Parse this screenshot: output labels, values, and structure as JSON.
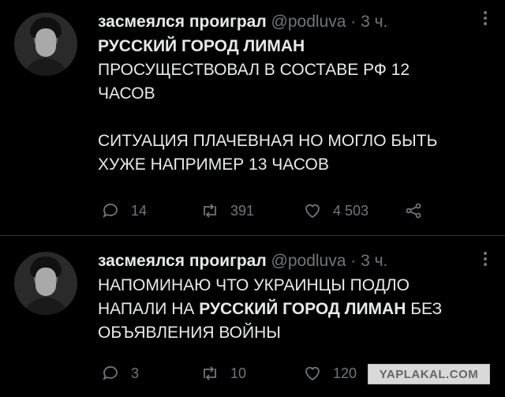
{
  "tweets": [
    {
      "author_name": "засмеялся проиграл",
      "handle": "@podluva",
      "time": "3 ч.",
      "text_bold": "РУССКИЙ ГОРОД ЛИМАН",
      "text_line1": "ПРОСУЩЕСТВОВАЛ В СОСТАВЕ РФ 12",
      "text_line2": "ЧАСОВ",
      "text_line3": "СИТУАЦИЯ ПЛАЧЕВНАЯ НО МОГЛО БЫТЬ",
      "text_line4": "ХУЖЕ НАПРИМЕР 13 ЧАСОВ",
      "replies": "14",
      "retweets": "391",
      "likes": "4 503"
    },
    {
      "author_name": "засмеялся проиграл",
      "handle": "@podluva",
      "time": "3 ч.",
      "text_line1": "НАПОМИНАЮ ЧТО УКРАИНЦЫ ПОДЛО",
      "text_line2_pre": "НАПАЛИ НА ",
      "text_line2_bold": "РУССКИЙ ГОРОД ЛИМАН",
      "text_line2_post": " БЕЗ",
      "text_line3": "ОБЪЯВЛЕНИЯ ВОЙНЫ",
      "replies": "3",
      "retweets": "10",
      "likes": "120"
    }
  ],
  "watermark": "YAPLAKAL.COM",
  "icons": [
    "reply-icon",
    "retweet-icon",
    "like-icon",
    "share-icon",
    "more-icon"
  ],
  "colors": {
    "background": "#000000",
    "text": "#e7e9ea",
    "muted": "#71767b",
    "divider": "#2f3336"
  }
}
